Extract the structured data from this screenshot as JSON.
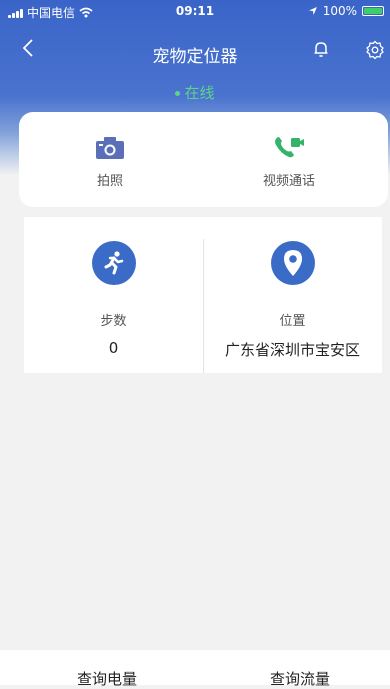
{
  "statusbar": {
    "carrier": "中国电信",
    "time": "09:11",
    "battery": "100%",
    "battery_level": 1.0
  },
  "nav": {
    "title": "宠物定位器"
  },
  "device": {
    "status": "在线",
    "status_color": "#5fd38c"
  },
  "actions": [
    {
      "label": "拍照"
    },
    {
      "label": "视频通话"
    }
  ],
  "stats": {
    "steps": {
      "label": "步数",
      "value": "0"
    },
    "location": {
      "label": "位置",
      "value": "广东省深圳市宝安区"
    }
  },
  "bottom": {
    "battery_query": "查询电量",
    "data_query": "查询流量"
  },
  "colors": {
    "primary": "#3a64c8",
    "icon_blue": "#3a6cc7",
    "camera_icon": "#5b6eb8",
    "video_icon": "#34b36b"
  }
}
